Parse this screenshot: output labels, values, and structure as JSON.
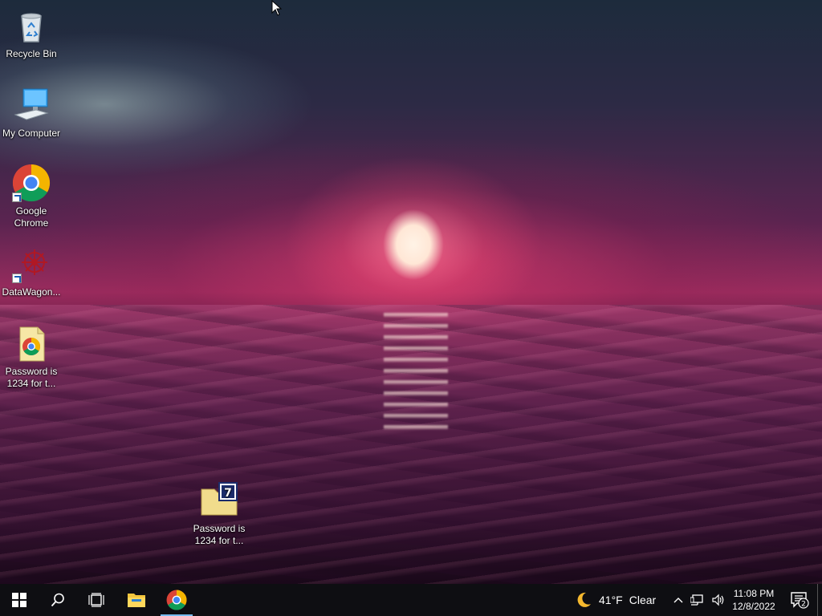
{
  "desktop": {
    "icons": [
      {
        "label": "Recycle Bin",
        "icon": "recycle-bin-icon"
      },
      {
        "label": "My Computer",
        "icon": "computer-icon"
      },
      {
        "label": "Google Chrome",
        "icon": "chrome-icon"
      },
      {
        "label": "DataWagon...",
        "icon": "datawagon-icon"
      },
      {
        "label": "Password is 1234 for t...",
        "icon": "chrome-document-icon"
      },
      {
        "label": "Password is 1234 for t...",
        "icon": "7zip-archive-icon"
      }
    ]
  },
  "taskbar": {
    "start": "windows-start-icon",
    "search": "search-icon",
    "task_view": "task-view-icon",
    "pinned": [
      {
        "name": "File Explorer",
        "icon": "file-explorer-icon"
      },
      {
        "name": "Google Chrome",
        "icon": "chrome-icon",
        "active": true
      }
    ],
    "weather": {
      "temp": "41°F",
      "condition": "Clear",
      "icon": "moon-icon"
    },
    "tray_icons": [
      "chevron-up-icon",
      "network-icon",
      "volume-icon"
    ],
    "clock": {
      "time": "11:08 PM",
      "date": "12/8/2022"
    },
    "notifications": {
      "count": "2",
      "icon": "action-center-icon"
    }
  },
  "colors": {
    "taskbar_bg": "#0e0e12",
    "active_indicator": "#76b9ed",
    "chrome_red": "#db4437",
    "chrome_green": "#0f9d58",
    "chrome_yellow": "#f4b400",
    "chrome_blue": "#4285f4"
  }
}
